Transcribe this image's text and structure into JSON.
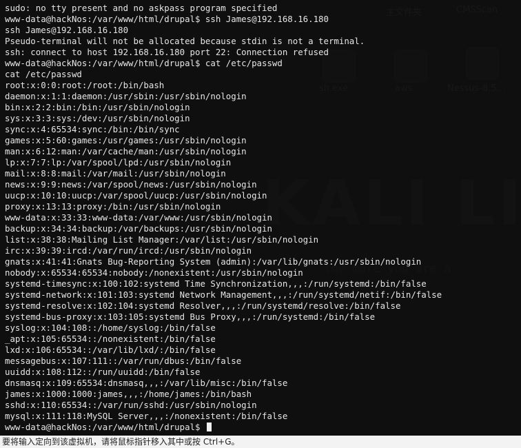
{
  "desktop": {
    "icon_labels": [
      "主文件夹",
      "CMSScan",
      "sh.exe",
      "aws",
      "Nessus-8.5..."
    ],
    "watermark": "KALI LINUX",
    "tagline": "the more you are a"
  },
  "terminal": {
    "lines": [
      "sudo: no tty present and no askpass program specified",
      "www-data@hackNos:/var/www/html/drupal$ ssh James@192.168.16.180",
      "ssh James@192.168.16.180",
      "Pseudo-terminal will not be allocated because stdin is not a terminal.",
      "ssh: connect to host 192.168.16.180 port 22: Connection refused",
      "www-data@hackNos:/var/www/html/drupal$ cat /etc/passwd",
      "cat /etc/passwd",
      "root:x:0:0:root:/root:/bin/bash",
      "daemon:x:1:1:daemon:/usr/sbin:/usr/sbin/nologin",
      "bin:x:2:2:bin:/bin:/usr/sbin/nologin",
      "sys:x:3:3:sys:/dev:/usr/sbin/nologin",
      "sync:x:4:65534:sync:/bin:/bin/sync",
      "games:x:5:60:games:/usr/games:/usr/sbin/nologin",
      "man:x:6:12:man:/var/cache/man:/usr/sbin/nologin",
      "lp:x:7:7:lp:/var/spool/lpd:/usr/sbin/nologin",
      "mail:x:8:8:mail:/var/mail:/usr/sbin/nologin",
      "news:x:9:9:news:/var/spool/news:/usr/sbin/nologin",
      "uucp:x:10:10:uucp:/var/spool/uucp:/usr/sbin/nologin",
      "proxy:x:13:13:proxy:/bin:/usr/sbin/nologin",
      "www-data:x:33:33:www-data:/var/www:/usr/sbin/nologin",
      "backup:x:34:34:backup:/var/backups:/usr/sbin/nologin",
      "list:x:38:38:Mailing List Manager:/var/list:/usr/sbin/nologin",
      "irc:x:39:39:ircd:/var/run/ircd:/usr/sbin/nologin",
      "gnats:x:41:41:Gnats Bug-Reporting System (admin):/var/lib/gnats:/usr/sbin/nologin",
      "nobody:x:65534:65534:nobody:/nonexistent:/usr/sbin/nologin",
      "systemd-timesync:x:100:102:systemd Time Synchronization,,,:/run/systemd:/bin/false",
      "systemd-network:x:101:103:systemd Network Management,,,:/run/systemd/netif:/bin/false",
      "systemd-resolve:x:102:104:systemd Resolver,,,:/run/systemd/resolve:/bin/false",
      "systemd-bus-proxy:x:103:105:systemd Bus Proxy,,,:/run/systemd:/bin/false",
      "syslog:x:104:108::/home/syslog:/bin/false",
      "_apt:x:105:65534::/nonexistent:/bin/false",
      "lxd:x:106:65534::/var/lib/lxd/:/bin/false",
      "messagebus:x:107:111::/var/run/dbus:/bin/false",
      "uuidd:x:108:112::/run/uuidd:/bin/false",
      "dnsmasq:x:109:65534:dnsmasq,,,:/var/lib/misc:/bin/false",
      "james:x:1000:1000:james,,,:/home/james:/bin/bash",
      "sshd:x:110:65534::/var/run/sshd:/usr/sbin/nologin",
      "mysql:x:111:118:MySQL Server,,,:/nonexistent:/bin/false"
    ],
    "prompt": "www-data@hackNos:/var/www/html/drupal$ "
  },
  "status_bar": {
    "text": "要将输入定向到该虚拟机，请将鼠标指针移入其中或按 Ctrl+G。"
  }
}
